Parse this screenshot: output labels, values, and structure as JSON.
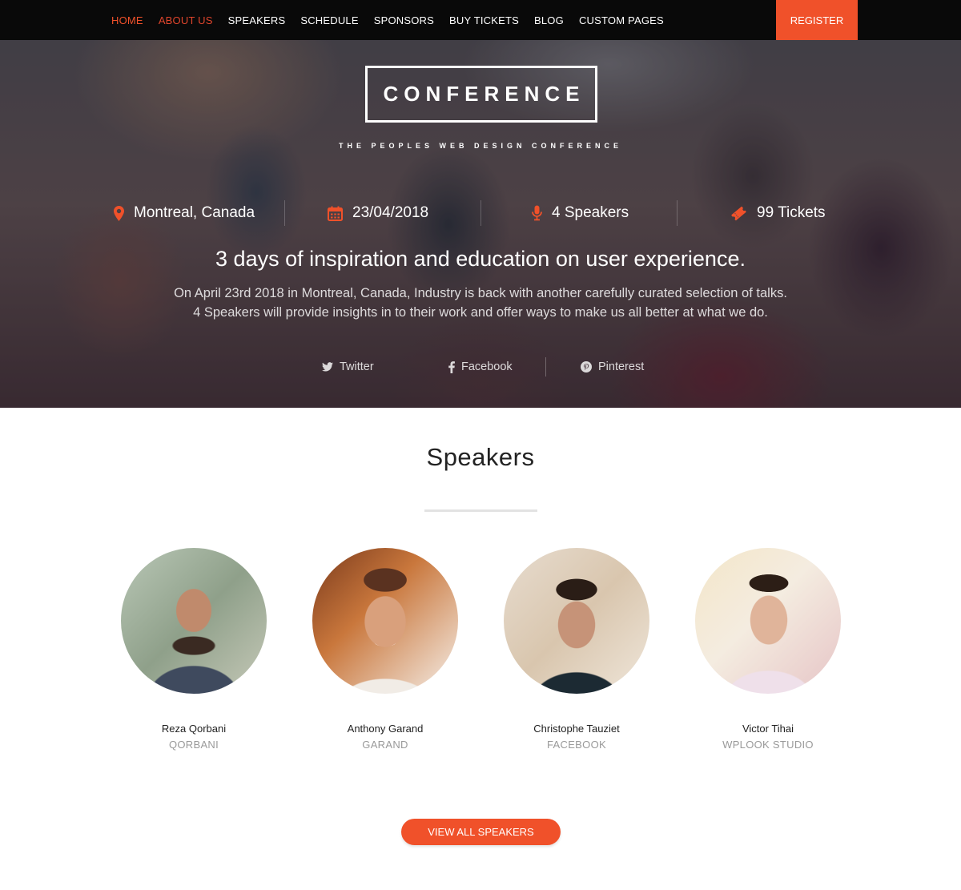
{
  "nav": {
    "items": [
      {
        "label": "HOME"
      },
      {
        "label": "ABOUT US"
      },
      {
        "label": "SPEAKERS"
      },
      {
        "label": "SCHEDULE"
      },
      {
        "label": "SPONSORS"
      },
      {
        "label": "BUY TICKETS"
      },
      {
        "label": "BLOG"
      },
      {
        "label": "CUSTOM PAGES"
      }
    ],
    "register_label": "REGISTER"
  },
  "hero": {
    "logo": "CONFERENCE",
    "tagline": "THE PEOPLES WEB DESIGN CONFERENCE",
    "stats": [
      {
        "icon": "map-pin-icon",
        "text": "Montreal, Canada"
      },
      {
        "icon": "calendar-icon",
        "text": "23/04/2018"
      },
      {
        "icon": "microphone-icon",
        "text": "4 Speakers"
      },
      {
        "icon": "ticket-icon",
        "text": "99 Tickets"
      }
    ],
    "headline": "3 days of inspiration and education on user experience.",
    "lead_line1": "On April 23rd 2018 in Montreal, Canada, Industry is back with another carefully curated selection of talks.",
    "lead_line2": "4 Speakers will provide insights in to their work and offer ways to make us all better at what we do.",
    "social": [
      {
        "icon": "twitter-icon",
        "label": "Twitter"
      },
      {
        "icon": "facebook-icon",
        "label": "Facebook"
      },
      {
        "icon": "pinterest-icon",
        "label": "Pinterest"
      }
    ]
  },
  "speakers": {
    "title": "Speakers",
    "items": [
      {
        "name": "Reza Qorbani",
        "company": "QORBANI"
      },
      {
        "name": "Anthony Garand",
        "company": "GARAND"
      },
      {
        "name": "Christophe Tauziet",
        "company": "FACEBOOK"
      },
      {
        "name": "Victor Tihai",
        "company": "WPLOOK STUDIO"
      }
    ],
    "cta_label": "VIEW ALL SPEAKERS"
  },
  "colors": {
    "accent": "#f0512a",
    "nav_background": "#090909",
    "muted_text": "#9a9a9a"
  }
}
